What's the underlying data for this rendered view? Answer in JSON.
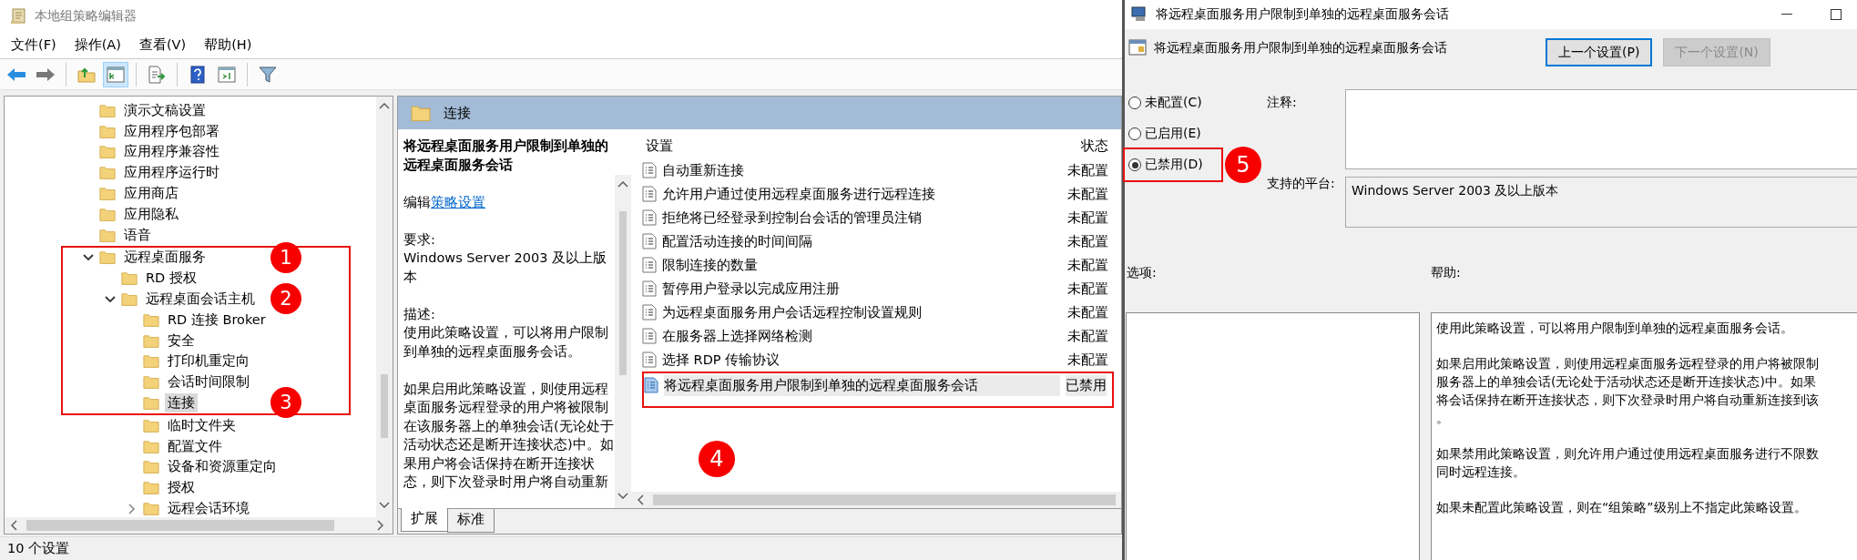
{
  "editor": {
    "title": "本地组策略编辑器",
    "menu": [
      {
        "label": "文件(F)"
      },
      {
        "label": "操作(A)"
      },
      {
        "label": "查看(V)"
      },
      {
        "label": "帮助(H)"
      }
    ],
    "toolbar": {
      "tree_toggle_pressed": true
    },
    "tree": [
      {
        "label": "演示文稿设置",
        "selected": false
      },
      {
        "label": "应用程序包部署",
        "selected": false
      },
      {
        "label": "应用程序兼容性",
        "selected": false
      },
      {
        "label": "应用程序运行时",
        "selected": false
      },
      {
        "label": "应用商店",
        "selected": false
      },
      {
        "label": "应用隐私",
        "selected": false
      },
      {
        "label": "语音",
        "selected": false
      },
      {
        "label": "远程桌面服务",
        "selected": false,
        "expanded": true,
        "boxed": true,
        "marker": "1",
        "children": [
          {
            "label": "RD 授权",
            "selected": false,
            "boxed": true
          },
          {
            "label": "远程桌面会话主机",
            "selected": false,
            "expanded": true,
            "boxed": true,
            "marker": "2",
            "children": [
              {
                "label": "RD 连接 Broker",
                "selected": false,
                "boxed": true
              },
              {
                "label": "安全",
                "selected": false,
                "boxed": true
              },
              {
                "label": "打印机重定向",
                "selected": false,
                "boxed": true
              },
              {
                "label": "会话时间限制",
                "selected": false,
                "boxed": true
              },
              {
                "label": "连接",
                "selected": true,
                "boxed": true,
                "marker": "3"
              },
              {
                "label": "临时文件夹",
                "selected": false
              },
              {
                "label": "配置文件",
                "selected": false
              },
              {
                "label": "设备和资源重定向",
                "selected": false
              },
              {
                "label": "授权",
                "selected": false
              },
              {
                "label": "远程会话环境",
                "selected": false,
                "expanded": false
              }
            ]
          }
        ]
      }
    ],
    "details": {
      "folder": "连接",
      "description": {
        "title": "将远程桌面服务用户限制到单独的远程桌面服务会话",
        "edit_prefix": "编辑",
        "edit_link": "策略设置",
        "requirements_label": "要求:",
        "requirements": "Windows Server 2003 及以上版本",
        "description_label": "描述:",
        "paragraphs": [
          "使用此策略设置，可以将用户限制到单独的远程桌面服务会话。",
          "如果启用此策略设置，则使用远程桌面服务远程登录的用户将被限制在该服务器上的单独会话(无论处于活动状态还是断开连接状态)中。如果用户将会话保持在断开连接状态，则下次登录时用户将自动重新"
        ]
      },
      "columns": [
        "设置",
        "状态"
      ],
      "rows": [
        {
          "name": "自动重新连接",
          "state": "未配置",
          "selected": false
        },
        {
          "name": "允许用户通过使用远程桌面服务进行远程连接",
          "state": "未配置",
          "selected": false
        },
        {
          "name": "拒绝将已经登录到控制台会话的管理员注销",
          "state": "未配置",
          "selected": false
        },
        {
          "name": "配置活动连接的时间间隔",
          "state": "未配置",
          "selected": false
        },
        {
          "name": "限制连接的数量",
          "state": "未配置",
          "selected": false
        },
        {
          "name": "暂停用户登录以完成应用注册",
          "state": "未配置",
          "selected": false
        },
        {
          "name": "为远程桌面服务用户会话远程控制设置规则",
          "state": "未配置",
          "selected": false
        },
        {
          "name": "在服务器上选择网络检测",
          "state": "未配置",
          "selected": false
        },
        {
          "name": "选择 RDP 传输协议",
          "state": "未配置",
          "selected": false
        },
        {
          "name": "将远程桌面服务用户限制到单独的远程桌面服务会话",
          "state": "已禁用",
          "selected": true,
          "boxed": true
        }
      ],
      "list_marker": "4"
    },
    "view_tabs": [
      {
        "label": "扩展",
        "selected": true
      },
      {
        "label": "标准",
        "selected": false
      }
    ],
    "status_bar": "10 个设置"
  },
  "dialog": {
    "title": "将远程桌面服务用户限制到单独的远程桌面服务会话",
    "heading": "将远程桌面服务用户限制到单独的远程桌面服务会话",
    "buttons": [
      {
        "label": "上一个设置(P)",
        "disabled": false
      },
      {
        "label": "下一个设置(N)",
        "disabled": true
      }
    ],
    "options": [
      {
        "label": "未配置(C)",
        "selected": false
      },
      {
        "label": "已启用(E)",
        "selected": false
      },
      {
        "label": "已禁用(D)",
        "selected": true,
        "boxed": true,
        "marker": "5"
      }
    ],
    "comment_label": "注释:",
    "platform_label": "支持的平台:",
    "platform": "Windows Server 2003 及以上版本",
    "options_label": "选项:",
    "help_label": "帮助:",
    "help": [
      [
        "使用此策略设置，可以将用户限制到单独的远程桌面服务会话。"
      ],
      [
        "如果启用此策略设置，则使用远程桌面服务远程登录的用户将被限制",
        "服务器上的单独会话(无论处于活动状态还是断开连接状态)中。如果",
        "将会话保持在断开连接状态，则下次登录时用户将自动重新连接到该",
        "。"
      ],
      [
        "如果禁用此策略设置，则允许用户通过使用远程桌面服务进行不限数",
        "同时远程连接。"
      ],
      [
        "如果未配置此策略设置，则在“组策略”级别上不指定此策略设置。"
      ]
    ]
  }
}
